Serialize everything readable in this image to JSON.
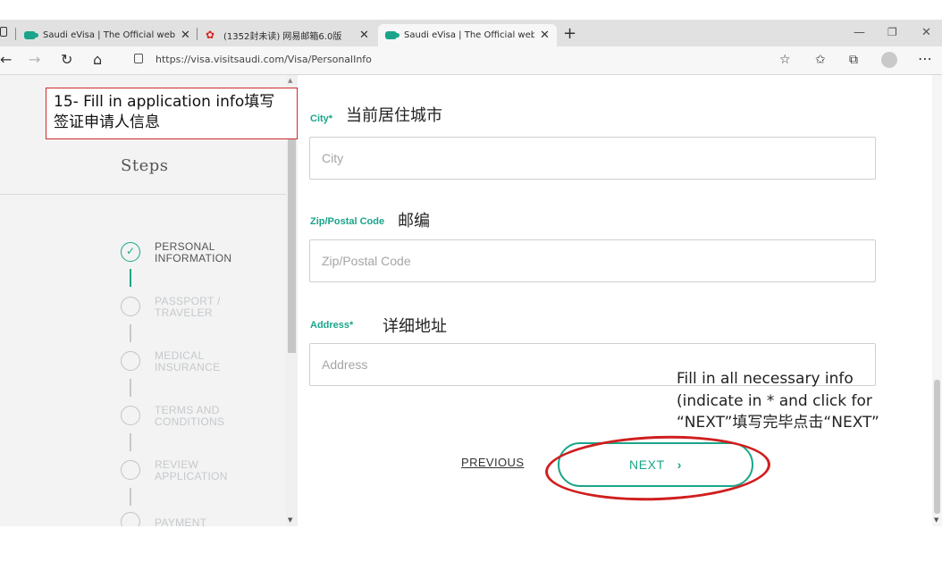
{
  "browser": {
    "tabs": [
      {
        "title": "Saudi eVisa | The Official website",
        "active": false
      },
      {
        "title": "(1352封未读) 网易邮箱6.0版",
        "active": false
      },
      {
        "title": "Saudi eVisa | The Official website",
        "active": true
      }
    ],
    "new_tab": "+",
    "url": "https://visa.visitsaudi.com/Visa/PersonalInfo",
    "window_controls": {
      "minimize": "—",
      "restore": "❐",
      "close": "✕"
    }
  },
  "sidebar": {
    "title": "Steps",
    "steps": [
      {
        "label_line1": "PERSONAL",
        "label_line2": "INFORMATION",
        "status": "done"
      },
      {
        "label_line1": "PASSPORT /",
        "label_line2": "TRAVELER",
        "status": "pending"
      },
      {
        "label_line1": "MEDICAL",
        "label_line2": "INSURANCE",
        "status": "pending"
      },
      {
        "label_line1": "TERMS AND",
        "label_line2": "CONDITIONS",
        "status": "pending"
      },
      {
        "label_line1": "REVIEW",
        "label_line2": "APPLICATION",
        "status": "pending"
      },
      {
        "label_line1": "PAYMENT",
        "label_line2": "",
        "status": "pending"
      }
    ]
  },
  "annotations": {
    "step_note_line1": "15- Fill in application info填写",
    "step_note_line2": "签证申请人信息",
    "next_note_line1": "Fill in all necessary info",
    "next_note_line2": "(indicate in * and click for",
    "next_note_line3": "“NEXT”填写完毕点击“NEXT”",
    "city_cn": "当前居住城市",
    "zip_cn": "邮编",
    "address_cn": "详细地址"
  },
  "form": {
    "city": {
      "label": "City*",
      "placeholder": "City",
      "value": ""
    },
    "zip": {
      "label": "Zip/Postal Code",
      "placeholder": "Zip/Postal Code",
      "value": ""
    },
    "address": {
      "label": "Address*",
      "placeholder": "Address",
      "value": ""
    }
  },
  "actions": {
    "previous": "PREVIOUS",
    "next": "NEXT",
    "next_chevron": "›"
  },
  "colors": {
    "accent": "#1aa58a",
    "annotation_red": "#d01e1e"
  }
}
